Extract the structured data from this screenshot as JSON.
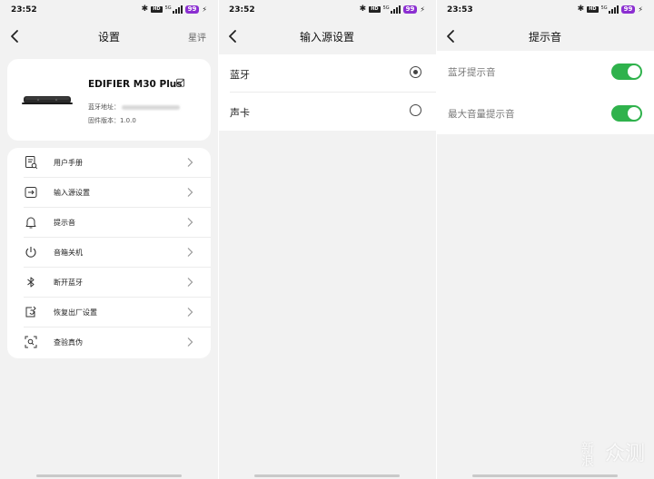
{
  "screens": [
    {
      "status": {
        "time": "23:52",
        "battery": "99",
        "net": "5G"
      },
      "nav": {
        "title": "设置",
        "right": "星评"
      },
      "device": {
        "name": "EDIFIER M30 Plus",
        "bt_label": "蓝牙地址：",
        "fw_label": "固件版本：",
        "fw_value": "1.0.0"
      },
      "menu": [
        {
          "label": "用户手册",
          "icon": "manual-icon"
        },
        {
          "label": "输入源设置",
          "icon": "input-source-icon"
        },
        {
          "label": "提示音",
          "icon": "bell-icon"
        },
        {
          "label": "音箱关机",
          "icon": "power-icon"
        },
        {
          "label": "断开蓝牙",
          "icon": "bluetooth-icon"
        },
        {
          "label": "恢复出厂设置",
          "icon": "reset-icon"
        },
        {
          "label": "查验真伪",
          "icon": "scan-icon"
        }
      ]
    },
    {
      "status": {
        "time": "23:52",
        "battery": "99",
        "net": "5G"
      },
      "nav": {
        "title": "输入源设置"
      },
      "options": [
        {
          "label": "蓝牙",
          "selected": true
        },
        {
          "label": "声卡",
          "selected": false
        }
      ]
    },
    {
      "status": {
        "time": "23:53",
        "battery": "99",
        "net": "5G"
      },
      "nav": {
        "title": "提示音"
      },
      "toggles": [
        {
          "label": "蓝牙提示音",
          "on": true
        },
        {
          "label": "最大音量提示音",
          "on": true
        }
      ]
    }
  ],
  "watermark": {
    "big": "众测",
    "small": "新浪"
  },
  "colors": {
    "toggle_on": "#2fb24c",
    "battery_badge": "#8b2fd1",
    "background": "#f2f2f2"
  }
}
